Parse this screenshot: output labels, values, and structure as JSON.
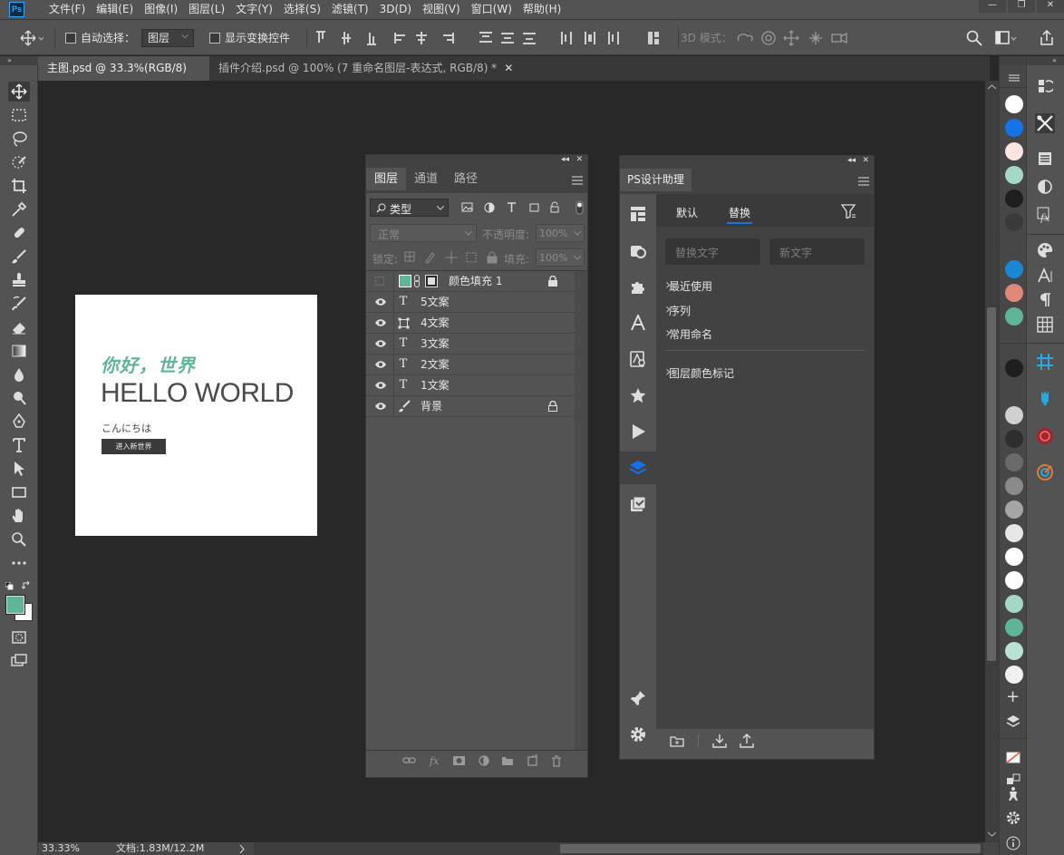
{
  "app": {
    "logo": "Ps"
  },
  "menu": [
    "文件(F)",
    "编辑(E)",
    "图像(I)",
    "图层(L)",
    "文字(Y)",
    "选择(S)",
    "滤镜(T)",
    "3D(D)",
    "视图(V)",
    "窗口(W)",
    "帮助(H)"
  ],
  "window_controls": {
    "minimize": "—",
    "restore": "❐",
    "close": "✕"
  },
  "options": {
    "auto_select_label": "自动选择：",
    "auto_select_value": "图层",
    "transform_controls_label": "显示变换控件",
    "mode_3d_label": "3D 模式："
  },
  "tabs": [
    {
      "label": "主图.psd @ 33.3%(RGB/8) *",
      "close": "✕"
    },
    {
      "label": "插件介绍.psd @ 100% (7 重命名图层-表达式, RGB/8) *",
      "close": "✕"
    }
  ],
  "artboard": {
    "greeting": "你好，世界",
    "headline": "HELLO WORLD",
    "japanese": "こんにちは",
    "button": "进入新世界",
    "greeting_color": "#5fb59a",
    "button_color": "#3a3a3a"
  },
  "layers_panel": {
    "tabs": [
      "图层",
      "通道",
      "路径"
    ],
    "filter_label": "类型",
    "blend_mode": "正常",
    "opacity_label": "不透明度:",
    "opacity_value": "100%",
    "lock_label": "锁定:",
    "fill_label": "填充:",
    "fill_value": "100%",
    "layers": [
      {
        "name": "颜色填充 1",
        "type": "fill",
        "visible": false,
        "locked": true,
        "swatch": "#5fb59a"
      },
      {
        "name": "5文案",
        "type": "text",
        "visible": true,
        "locked": false
      },
      {
        "name": "4文案",
        "type": "shape",
        "visible": true,
        "locked": false
      },
      {
        "name": "3文案",
        "type": "text",
        "visible": true,
        "locked": false
      },
      {
        "name": "2文案",
        "type": "text",
        "visible": true,
        "locked": false
      },
      {
        "name": "1文案",
        "type": "text",
        "visible": true,
        "locked": false
      },
      {
        "name": "背景",
        "type": "brush",
        "visible": true,
        "locked": true
      }
    ],
    "footer_icons": [
      "link-icon",
      "fx-icon",
      "mask-icon",
      "adjustment-icon",
      "folder-icon",
      "new-layer-icon",
      "trash-icon"
    ]
  },
  "assistant_panel": {
    "title": "PS设计助理",
    "tabs": [
      "默认",
      "替换"
    ],
    "active_tab": "替换",
    "find_placeholder": "替换文字",
    "replace_placeholder": "新文字",
    "tree": [
      "最近使用",
      "序列",
      "常用命名"
    ],
    "tree2": [
      "图层颜色标记"
    ]
  },
  "status": {
    "zoom": "33.33%",
    "doc": "文档:1.83M/12.2M"
  },
  "swatches": [
    "#ffffff",
    "#1473e6",
    "#fde4e1",
    "#a2d8c4",
    "#1e1e1e",
    "#3a3a3a",
    "#474747",
    "#1887d4",
    "#e0887a",
    "#5fb59a"
  ],
  "swatches2": [
    "#1e1e1e",
    "#474747",
    "#d0d0d0",
    "#2e2e2e",
    "#6a6a6a",
    "#8a8a8a",
    "#a5a5a5",
    "#e6e6e6",
    "#ffffff",
    "#ffffff",
    "#a2d8c4",
    "#5fb59a",
    "#b9e2d4",
    "#f0f0f0"
  ],
  "colors": {
    "foreground": "#5fb59a",
    "background": "#ffffff",
    "accent": "#1473e6"
  }
}
